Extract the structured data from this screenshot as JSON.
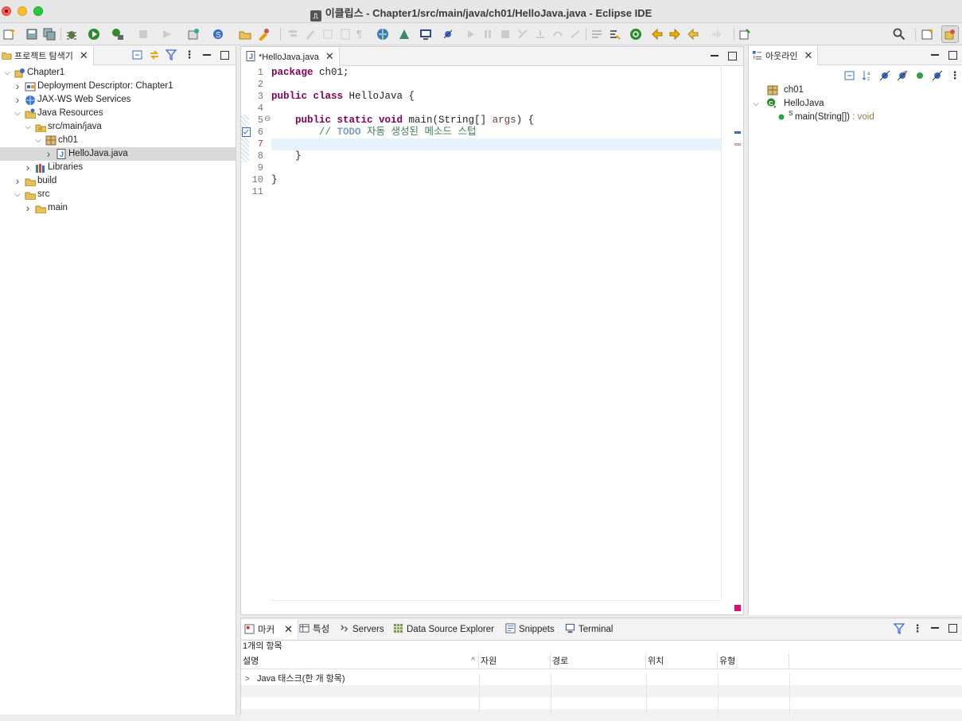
{
  "window": {
    "title": "이클립스 - Chapter1/src/main/java/ch01/HelloJava.java - Eclipse IDE"
  },
  "colors": {
    "keyword": "#7f0055",
    "comment": "#3f7f5f",
    "todo": "#7f9fbf",
    "current_line": "#e8f2fe",
    "selection": "#d9d9d9"
  },
  "project_explorer": {
    "tab_label": "프로젝트 탐색기",
    "tree": [
      {
        "label": "Chapter1",
        "depth": 0,
        "expanded": true,
        "icon": "project-icon"
      },
      {
        "label": "Deployment Descriptor: Chapter1",
        "depth": 1,
        "expanded": false,
        "icon": "descriptor-icon"
      },
      {
        "label": "JAX-WS Web Services",
        "depth": 1,
        "expanded": false,
        "icon": "webservice-icon"
      },
      {
        "label": "Java Resources",
        "depth": 1,
        "expanded": true,
        "icon": "java-resources-icon"
      },
      {
        "label": "src/main/java",
        "depth": 2,
        "expanded": true,
        "icon": "source-folder-icon"
      },
      {
        "label": "ch01",
        "depth": 3,
        "expanded": true,
        "icon": "package-icon"
      },
      {
        "label": "HelloJava.java",
        "depth": 4,
        "expanded": false,
        "icon": "java-file-icon",
        "selected": true
      },
      {
        "label": "Libraries",
        "depth": 2,
        "expanded": false,
        "icon": "libraries-icon"
      },
      {
        "label": "build",
        "depth": 1,
        "expanded": false,
        "icon": "folder-icon"
      },
      {
        "label": "src",
        "depth": 1,
        "expanded": true,
        "icon": "folder-icon"
      },
      {
        "label": "main",
        "depth": 2,
        "expanded": false,
        "icon": "folder-icon"
      }
    ]
  },
  "editor": {
    "tab_label": "*HelloJava.java",
    "line_numbers": [
      "1",
      "2",
      "3",
      "4",
      "5",
      "6",
      "7",
      "8",
      "9",
      "10",
      "11"
    ],
    "code": {
      "l1_kw": "package",
      "l1_rest": " ch01;",
      "l3_kw": "public class",
      "l3_rest": " HelloJava {",
      "l5_indent": "    ",
      "l5_kw": "public static void",
      "l5_mid": " main(String[] ",
      "l5_param": "args",
      "l5_end": ") {",
      "l6_indent": "        ",
      "l6_comment": "// ",
      "l6_todo": "TODO",
      "l6_text": " 자동 생성된 메소드 스텁",
      "l8": "    }",
      "l10": "}"
    }
  },
  "outline": {
    "tab_label": "아웃라인",
    "items": [
      {
        "label": "ch01",
        "icon": "package-icon"
      },
      {
        "label": "HelloJava",
        "icon": "class-icon"
      },
      {
        "label": "main(String[])",
        "suffix": " : void",
        "icon": "method-icon",
        "modifier": "S"
      }
    ]
  },
  "bottom_panel": {
    "tabs": [
      {
        "label": "마커",
        "icon": "markers-icon"
      },
      {
        "label": "특성",
        "icon": "properties-icon"
      },
      {
        "label": "Servers",
        "icon": "servers-icon"
      },
      {
        "label": "Data Source Explorer",
        "icon": "datasource-icon"
      },
      {
        "label": "Snippets",
        "icon": "snippets-icon"
      },
      {
        "label": "Terminal",
        "icon": "terminal-icon"
      }
    ],
    "summary": "1개의 항목",
    "columns": [
      "설명",
      "자원",
      "경로",
      "위치",
      "유형"
    ],
    "rows": [
      {
        "description": "Java 태스크(한 개 항목)"
      }
    ]
  }
}
